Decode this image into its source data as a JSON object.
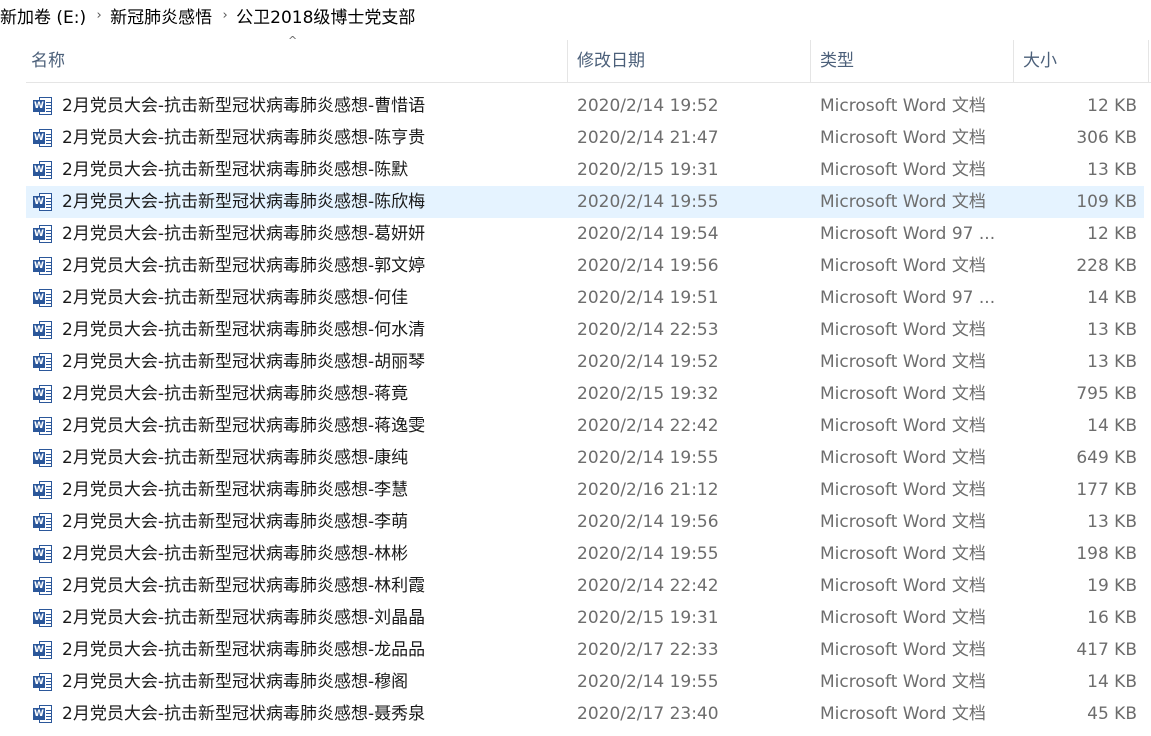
{
  "breadcrumb": {
    "items": [
      "新加卷 (E:)",
      "新冠肺炎感悟",
      "公卫2018级博士党支部"
    ],
    "separator": "›"
  },
  "columns": {
    "name": "名称",
    "date": "修改日期",
    "type": "类型",
    "size": "大小",
    "sort_indicator": "^"
  },
  "icon": {
    "name": "word-document-icon",
    "badge_letter": "W",
    "color": "#2b579a"
  },
  "selection": {
    "highlight_color": "#e5f3ff",
    "selected_index": 3
  },
  "files": [
    {
      "name": "2月党员大会-抗击新型冠状病毒肺炎感想-曹惜语",
      "date": "2020/2/14 19:52",
      "type": "Microsoft Word 文档",
      "size": "12 KB"
    },
    {
      "name": "2月党员大会-抗击新型冠状病毒肺炎感想-陈亨贵",
      "date": "2020/2/14 21:47",
      "type": "Microsoft Word 文档",
      "size": "306 KB"
    },
    {
      "name": "2月党员大会-抗击新型冠状病毒肺炎感想-陈默",
      "date": "2020/2/15 19:31",
      "type": "Microsoft Word 文档",
      "size": "13 KB"
    },
    {
      "name": "2月党员大会-抗击新型冠状病毒肺炎感想-陈欣梅",
      "date": "2020/2/14 19:55",
      "type": "Microsoft Word 文档",
      "size": "109 KB"
    },
    {
      "name": "2月党员大会-抗击新型冠状病毒肺炎感想-葛妍妍",
      "date": "2020/2/14 19:54",
      "type": "Microsoft Word 97 ...",
      "size": "12 KB"
    },
    {
      "name": "2月党员大会-抗击新型冠状病毒肺炎感想-郭文婷",
      "date": "2020/2/14 19:56",
      "type": "Microsoft Word 文档",
      "size": "228 KB"
    },
    {
      "name": "2月党员大会-抗击新型冠状病毒肺炎感想-何佳",
      "date": "2020/2/14 19:51",
      "type": "Microsoft Word 97 ...",
      "size": "14 KB"
    },
    {
      "name": "2月党员大会-抗击新型冠状病毒肺炎感想-何水清",
      "date": "2020/2/14 22:53",
      "type": "Microsoft Word 文档",
      "size": "13 KB"
    },
    {
      "name": "2月党员大会-抗击新型冠状病毒肺炎感想-胡丽琴",
      "date": "2020/2/14 19:52",
      "type": "Microsoft Word 文档",
      "size": "13 KB"
    },
    {
      "name": "2月党员大会-抗击新型冠状病毒肺炎感想-蒋竟",
      "date": "2020/2/15 19:32",
      "type": "Microsoft Word 文档",
      "size": "795 KB"
    },
    {
      "name": "2月党员大会-抗击新型冠状病毒肺炎感想-蒋逸雯",
      "date": "2020/2/14 22:42",
      "type": "Microsoft Word 文档",
      "size": "14 KB"
    },
    {
      "name": "2月党员大会-抗击新型冠状病毒肺炎感想-康纯",
      "date": "2020/2/14 19:55",
      "type": "Microsoft Word 文档",
      "size": "649 KB"
    },
    {
      "name": "2月党员大会-抗击新型冠状病毒肺炎感想-李慧",
      "date": "2020/2/16 21:12",
      "type": "Microsoft Word 文档",
      "size": "177 KB"
    },
    {
      "name": "2月党员大会-抗击新型冠状病毒肺炎感想-李萌",
      "date": "2020/2/14 19:56",
      "type": "Microsoft Word 文档",
      "size": "13 KB"
    },
    {
      "name": "2月党员大会-抗击新型冠状病毒肺炎感想-林彬",
      "date": "2020/2/14 19:55",
      "type": "Microsoft Word 文档",
      "size": "198 KB"
    },
    {
      "name": "2月党员大会-抗击新型冠状病毒肺炎感想-林利霞",
      "date": "2020/2/14 22:42",
      "type": "Microsoft Word 文档",
      "size": "19 KB"
    },
    {
      "name": "2月党员大会-抗击新型冠状病毒肺炎感想-刘晶晶",
      "date": "2020/2/15 19:31",
      "type": "Microsoft Word 文档",
      "size": "16 KB"
    },
    {
      "name": "2月党员大会-抗击新型冠状病毒肺炎感想-龙品品",
      "date": "2020/2/17 22:33",
      "type": "Microsoft Word 文档",
      "size": "417 KB"
    },
    {
      "name": "2月党员大会-抗击新型冠状病毒肺炎感想-穆阁",
      "date": "2020/2/14 19:55",
      "type": "Microsoft Word 文档",
      "size": "14 KB"
    },
    {
      "name": "2月党员大会-抗击新型冠状病毒肺炎感想-聂秀泉",
      "date": "2020/2/17 23:40",
      "type": "Microsoft Word 文档",
      "size": "45 KB"
    }
  ]
}
